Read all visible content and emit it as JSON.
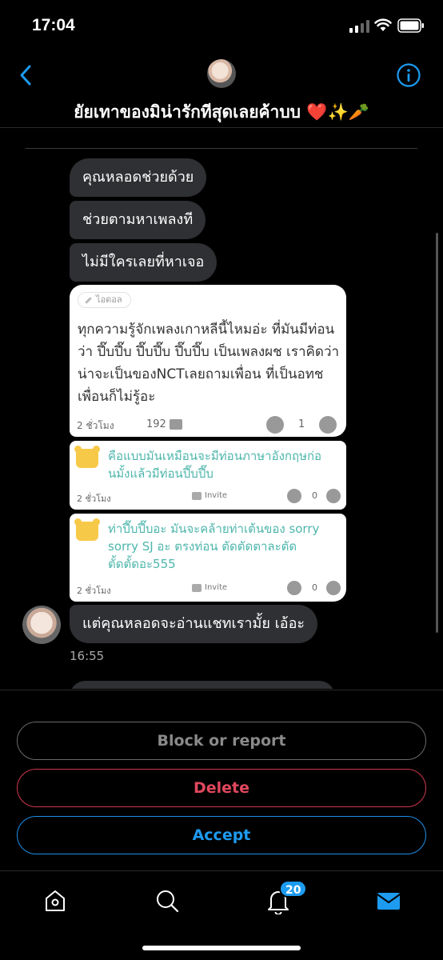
{
  "status_bar": {
    "time": "17:04"
  },
  "header": {
    "title": "ยัยเทาของมิน่ารักทีสุดเลยค้าบบ ❤️✨🥕"
  },
  "messages": {
    "bubbles": [
      "คุณหลอดช่วยด้วย",
      "ช่วยตามหาเพลงที",
      "ไม่มีใครเลยที่หาเจอ"
    ],
    "shared_post": {
      "tag": "ไอดอล",
      "text": "ทุกความรู้จักเพลงเกาหลีนี้ไหมอ่ะ ที่มันมีท่อนว่า ปึ๊บปึ๊บ ปึ๊บปึ๊บ ปึ๊บปึ๊บ เป็นเพลงผช เราคิดว่าน่าจะเป็นของNCTเลยถามเพื่อน ที่เป็นอทช เพื่อนก็ไม่รู้อะ",
      "time": "2 ชั่วโมง",
      "comments": "192",
      "likes": "1"
    },
    "comments": [
      {
        "text": "คือแบบมันเหมือนจะมีท่อนภาษาอังกฤษก่อนมั้งแล้วมีท่อนปึ๊บปึ๊บ",
        "time": "2 ชั่วโมง",
        "invite": "Invite",
        "likes": "0"
      },
      {
        "text": "ท่าปึ๊บปึ๊บอะ มันจะคล้ายท่าเต้นของ sorry sorry SJ อะ ตรงท่อน ตัดตัดตาละตัด ตั้ดตั้ดอะ555",
        "time": "2 ชั่วโมง",
        "invite": "Invite",
        "likes": "0"
      }
    ],
    "last_bubble": "แต่คุณหลอดจะอ่านแชทเรามั้ย เอ้อะ",
    "last_time": "16:55"
  },
  "actions": {
    "block": "Block or report",
    "delete": "Delete",
    "accept": "Accept"
  },
  "tabbar": {
    "notifications_badge": "20"
  },
  "colors": {
    "accent": "#1d9bf0",
    "delete": "#e0485e",
    "comment_text": "#4db6ac"
  }
}
